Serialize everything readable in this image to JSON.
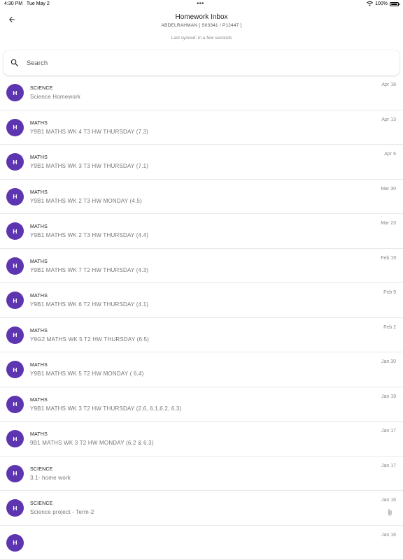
{
  "status_bar": {
    "time": "4:30 PM",
    "date": "Tue May 2",
    "battery": "100%",
    "icons": [
      "wifi-icon",
      "battery-icon"
    ]
  },
  "header": {
    "title": "Homework Inbox",
    "subtitle": "ABDELRAHMAN [ S03341 / P12447 ]",
    "synced": "Last synced: in a few seconds",
    "back_icon": "arrow-left-icon"
  },
  "search": {
    "placeholder": "Search",
    "value": "",
    "icon": "search-icon"
  },
  "colors": {
    "avatar_bg": "#5e35b1",
    "avatar_fg": "#ffffff"
  },
  "items": [
    {
      "avatar": "H",
      "subject": "SCIENCE",
      "desc": "Science Homework",
      "date": "Apr 18",
      "attachment": false
    },
    {
      "avatar": "H",
      "subject": "MATHS",
      "desc": "Y9B1 MATHS WK 4 T3 HW THURSDAY (7.3)",
      "date": "Apr 13",
      "attachment": false
    },
    {
      "avatar": "H",
      "subject": "MATHS",
      "desc": "Y9B1 MATHS WK 3 T3 HW THURSDAY (7.1)",
      "date": "Apr 6",
      "attachment": false
    },
    {
      "avatar": "H",
      "subject": "MATHS",
      "desc": "Y9B1 MATHS WK 2 T3 HW MONDAY (4.5)",
      "date": "Mar 30",
      "attachment": false
    },
    {
      "avatar": "H",
      "subject": "MATHS",
      "desc": "Y9B1 MATHS WK 2 T3 HW THURSDAY (4.4)",
      "date": "Mar 23",
      "attachment": false
    },
    {
      "avatar": "H",
      "subject": "MATHS",
      "desc": "Y9B1 MATHS WK 7 T2 HW THURSDAY (4.3)",
      "date": "Feb 19",
      "attachment": false
    },
    {
      "avatar": "H",
      "subject": "MATHS",
      "desc": "Y9B1 MATHS WK 6 T2 HW THURSDAY (4.1)",
      "date": "Feb 9",
      "attachment": false
    },
    {
      "avatar": "H",
      "subject": "MATHS",
      "desc": "Y9G2 MATHS WK 5 T2 HW THURSDAY (6.5)",
      "date": "Feb 2",
      "attachment": false
    },
    {
      "avatar": "H",
      "subject": "MATHS",
      "desc": "Y9B1 MATHS WK 5 T2 HW MONDAY ( 6.4)",
      "date": "Jan 30",
      "attachment": false
    },
    {
      "avatar": "H",
      "subject": "MATHS",
      "desc": "Y9B1 MATHS WK 3 T2 HW THURSDAY (2.6, 6.1,6.2, 6.3)",
      "date": "Jan 19",
      "attachment": false
    },
    {
      "avatar": "H",
      "subject": "MATHS",
      "desc": "9B1 MATHS WK 3 T2 HW MONDAY (6.2 & 6.3)",
      "date": "Jan 17",
      "attachment": false
    },
    {
      "avatar": "H",
      "subject": "SCIENCE",
      "desc": "3.1- home work",
      "date": "Jan 17",
      "attachment": false
    },
    {
      "avatar": "H",
      "subject": "SCIENCE",
      "desc": "Science project - Term-2",
      "date": "Jan 16",
      "attachment": true
    },
    {
      "avatar": "H",
      "subject": "",
      "desc": "",
      "date": "Jan 16",
      "attachment": false
    }
  ]
}
